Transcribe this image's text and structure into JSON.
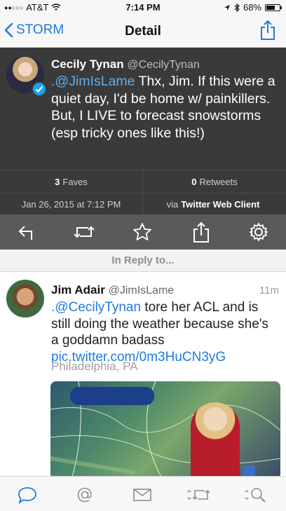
{
  "status_bar": {
    "carrier": "AT&T",
    "time": "7:14 PM",
    "battery": "68%",
    "battery_level": 0.68
  },
  "nav": {
    "back_label": "STORM",
    "title": "Detail"
  },
  "main_tweet": {
    "author_name": "Cecily Tynan",
    "author_handle": "@CecilyTynan",
    "mention": ".@JimIsLame",
    "text": " Thx, Jim. If this were a quiet day, I'd be home w/ painkillers. But, I LIVE to forecast snowstorms (esp tricky ones like this!)"
  },
  "stats": {
    "faves_count": "3",
    "faves_label": "Faves",
    "retweets_count": "0",
    "retweets_label": "Retweets",
    "timestamp": "Jan 26, 2015 at 7:12 PM",
    "via_prefix": "via",
    "via_client": "Twitter Web Client"
  },
  "in_reply_label": "In Reply to...",
  "reply_tweet": {
    "author_name": "Jim Adair",
    "author_handle": "@JimIsLame",
    "time": "11m",
    "mention": ".@CecilyTynan",
    "text": " tore her ACL and is still doing the weather because she's a goddamn badass ",
    "link": "pic.twitter.com/0m3HuCN3yG",
    "location": "Philadelphia, PA"
  },
  "icons": {
    "reply": "reply-icon",
    "retweet": "retweet-icon",
    "favorite": "star-icon",
    "share": "share-icon",
    "settings": "gear-icon",
    "tab_timeline": "speech-bubble-icon",
    "tab_mentions": "at-icon",
    "tab_messages": "envelope-icon",
    "tab_retweets": "retweet-icon",
    "tab_search": "search-icon"
  },
  "colors": {
    "accent": "#1f7ae0",
    "dark_bg": "#3a3a3a",
    "action_bar": "#5a5a5a"
  }
}
